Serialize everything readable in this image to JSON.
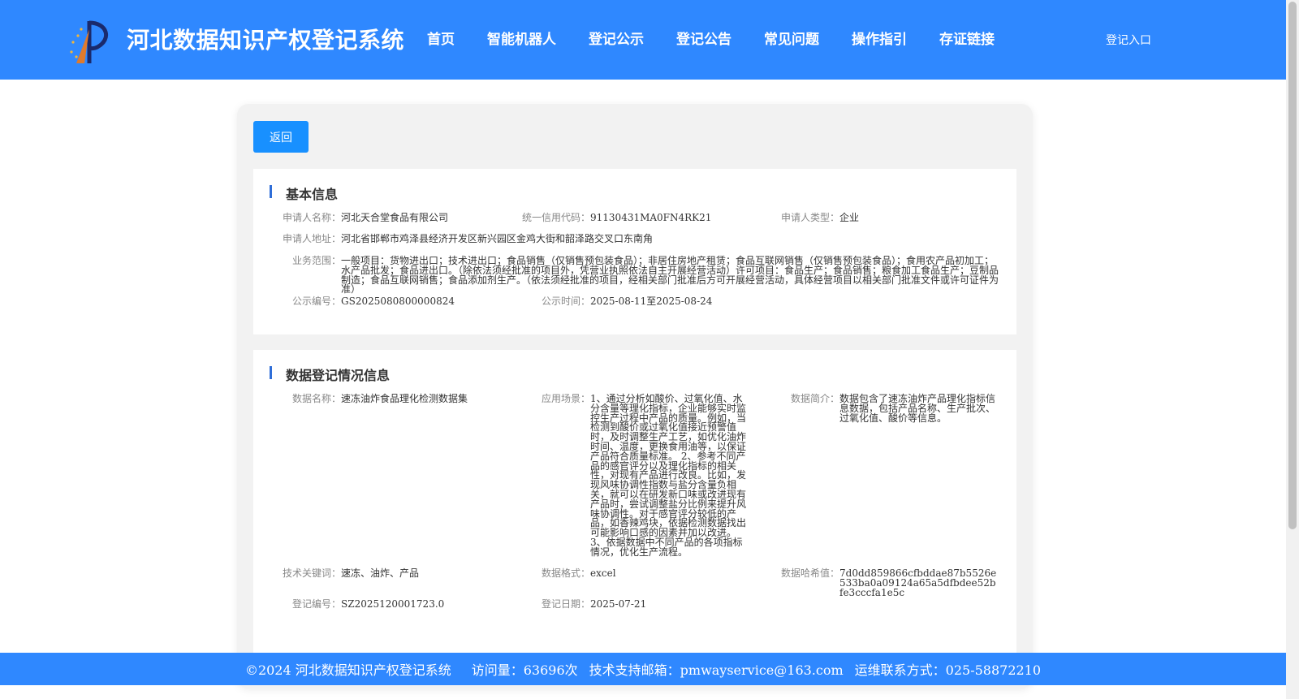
{
  "header": {
    "title": "河北数据知识产权登记系统",
    "nav": [
      "首页",
      "智能机器人",
      "登记公示",
      "登记公告",
      "常见问题",
      "操作指引",
      "存证链接"
    ],
    "login": "登记入口"
  },
  "back_label": "返回",
  "basic": {
    "title": "基本信息",
    "applicant_name_label": "申请人名称：",
    "applicant_name": "河北天合堂食品有限公司",
    "credit_code_label": "统一信用代码：",
    "credit_code": "91130431MA0FN4RK21",
    "applicant_type_label": "申请人类型：",
    "applicant_type": "企业",
    "address_label": "申请人地址：",
    "address": "河北省邯郸市鸡泽县经济开发区新兴园区金鸡大街和韶泽路交叉口东南角",
    "scope_label": "业务范围：",
    "scope": "一般项目：货物进出口；技术进出口；食品销售（仅销售预包装食品）；非居住房地产租赁；食品互联网销售（仅销售预包装食品）；食用农产品初加工；水产品批发；食品进出口。（除依法须经批准的项目外，凭营业执照依法自主开展经营活动）许可项目：食品生产；食品销售；粮食加工食品生产；豆制品制造；食品互联网销售；食品添加剂生产。（依法须经批准的项目，经相关部门批准后方可开展经营活动，具体经营项目以相关部门批准文件或许可证件为准）",
    "pub_no_label": "公示编号：",
    "pub_no": "GS2025080800000824",
    "pub_time_label": "公示时间：",
    "pub_time": "2025-08-11至2025-08-24"
  },
  "reg": {
    "title": "数据登记情况信息",
    "data_name_label": "数据名称：",
    "data_name": "速冻油炸食品理化检测数据集",
    "scene_label": "应用场景：",
    "scene": "1、通过分析如酸价、过氧化值、水分含量等理化指标，企业能够实时监控生产过程中产品的质量。例如，当检测到酸价或过氧化值接近预警值时，及时调整生产工艺，如优化油炸时间、温度，更换食用油等，以保证产品符合质量标准。 2、参考不同产品的感官评分以及理化指标的相关性，对现有产品进行改良。比如，发现风味协调性指数与盐分含量负相关，就可以在研发新口味或改进现有产品时，尝试调整盐分比例来提升风味协调性。对于感官评分较低的产品，如香辣鸡块，依据检测数据找出可能影响口感的因素并加以改进。 3、依据数据中不同产品的各项指标情况，优化生产流程。",
    "intro_label": "数据简介：",
    "intro": "数据包含了速冻油炸产品理化指标信息数据，包括产品名称、生产批次、过氧化值、酸价等信息。",
    "keywords_label": "技术关键词：",
    "keywords": "速冻、油炸、产品",
    "format_label": "数据格式：",
    "format": "excel",
    "hash_label": "数据哈希值：",
    "hash": "7d0dd859866cfbddae87b5526e533ba0a09124a65a5dfbdee52bfe3cccfa1e5c",
    "reg_no_label": "登记编号：",
    "reg_no": "SZ2025120001723.0",
    "reg_date_label": "登记日期：",
    "reg_date": "2025-07-21"
  },
  "footer": {
    "copyright": "©2024 河北数据知识产权登记系统",
    "visits": "访问量：63696次",
    "email": "技术支持邮箱：pmwayservice@163.com",
    "phone": "运维联系方式：025-58872210"
  },
  "colors": {
    "primary": "#2f88ff",
    "button": "#1890ff",
    "accent_bar": "#2f6ed8"
  }
}
